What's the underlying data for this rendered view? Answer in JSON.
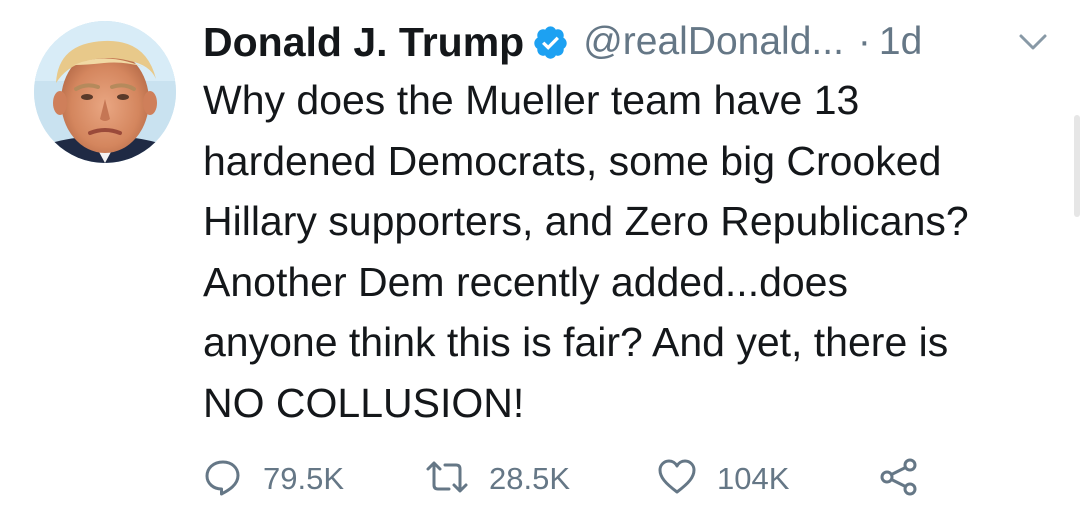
{
  "tweet": {
    "author_name": "Donald J. Trump",
    "handle": "@realDonald...",
    "separator": "·",
    "time": "1d",
    "text_lines": [
      "Why does the Mueller team have 13",
      "hardened Democrats, some big Crooked",
      "Hillary supporters, and Zero Republicans?",
      "Another Dem recently added...does",
      "anyone think this is fair? And yet, there is",
      "NO COLLUSION!"
    ],
    "reply_count": "79.5K",
    "retweet_count": "28.5K",
    "like_count": "104K"
  },
  "icons": {
    "verified": "verified-badge-icon",
    "caret": "chevron-down-icon",
    "reply": "speech-bubble-icon",
    "retweet": "retweet-arrows-icon",
    "like": "heart-icon",
    "share": "share-nodes-icon"
  },
  "colors": {
    "text": "#14171a",
    "secondary": "#657786",
    "verified_blue": "#1da1f2",
    "icon_gray": "#657786"
  }
}
